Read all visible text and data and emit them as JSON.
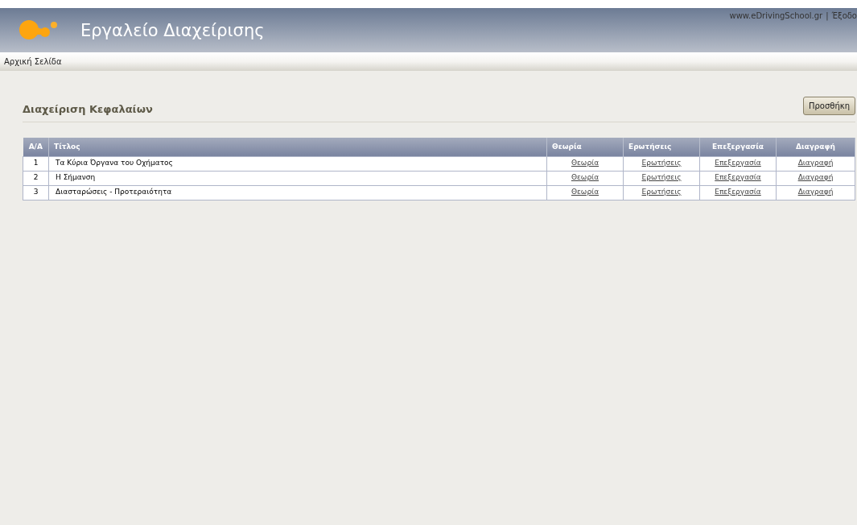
{
  "header": {
    "title": "Εργαλείο Διαχείρισης",
    "links": [
      "www.eDrivingSchool.gr",
      "Έξοδο"
    ],
    "separator": "|"
  },
  "nav": {
    "items": [
      "Αρχική Σελίδα"
    ]
  },
  "page": {
    "title": "Διαχείριση Κεφαλαίων",
    "add_button": "Προσθήκη"
  },
  "table": {
    "columns": [
      "Α/Α",
      "Τίτλος",
      "Θεωρία",
      "Ερωτήσεις",
      "Επεξεργασία",
      "Διαγραφή"
    ],
    "rows": [
      {
        "index": "1",
        "title": "Τα Κύρια Όργανα του Οχήματος",
        "links": [
          "Θεωρία",
          "Ερωτήσεις",
          "Επεξεργασία",
          "Διαγραφή"
        ]
      },
      {
        "index": "2",
        "title": "Η Σήμανση",
        "links": [
          "Θεωρία",
          "Ερωτήσεις",
          "Επεξεργασία",
          "Διαγραφή"
        ]
      },
      {
        "index": "3",
        "title": "Διασταρώσεις - Προτεραιότητα",
        "links": [
          "Θεωρία",
          "Ερωτήσεις",
          "Επεξεργασία",
          "Διαγραφή"
        ]
      }
    ]
  }
}
